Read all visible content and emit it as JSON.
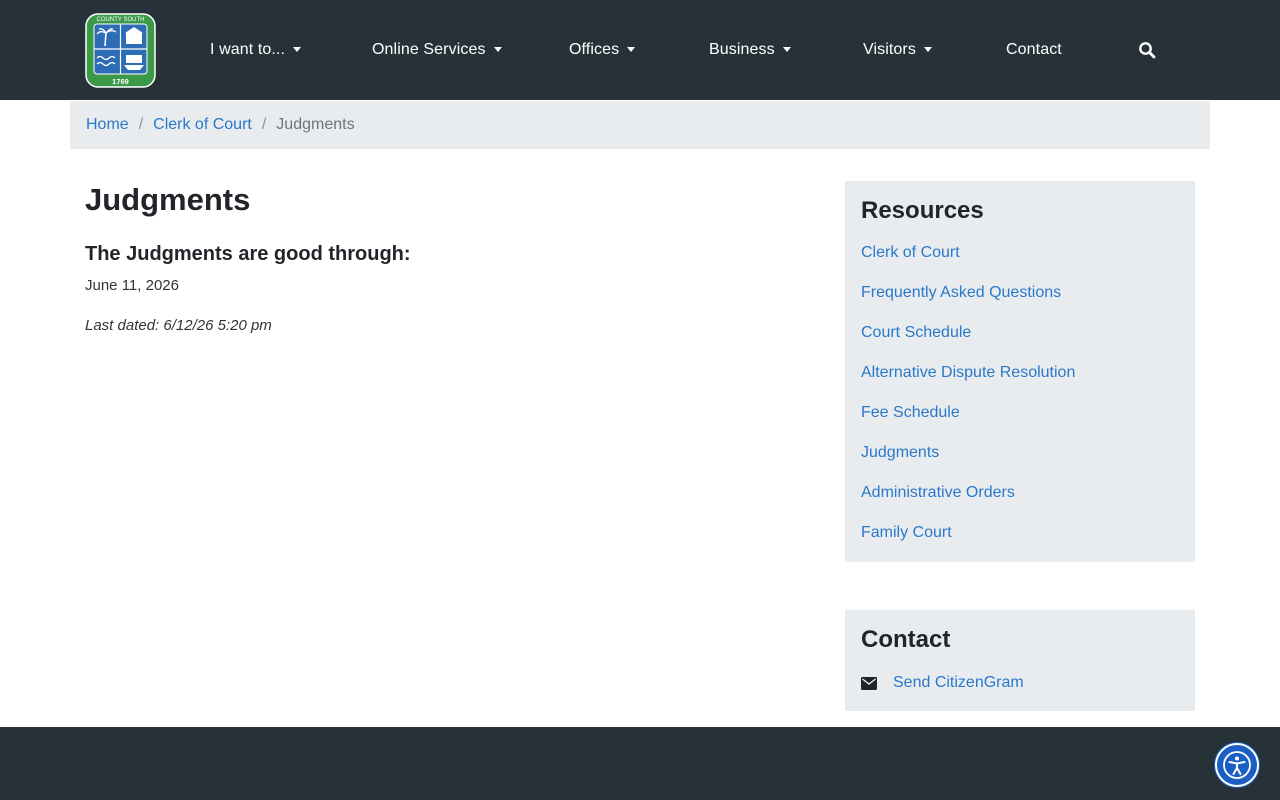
{
  "brand": {
    "logo_alt": "Beaufort County South Carolina seal",
    "logo_top_text": "BEAUFORT COUNTY SOUTH CAROLINA",
    "logo_year": "1769",
    "colors": {
      "header": "#263238",
      "logo_green": "#3a9a48",
      "logo_blue": "#2d6db5",
      "link": "#2a78c9",
      "panel": "#e9ecef"
    }
  },
  "nav": {
    "items": [
      {
        "label": "I want to...",
        "dropdown": true
      },
      {
        "label": "Online Services",
        "dropdown": true
      },
      {
        "label": "Offices",
        "dropdown": true
      },
      {
        "label": "Business",
        "dropdown": true
      },
      {
        "label": "Visitors",
        "dropdown": true
      },
      {
        "label": "Contact",
        "dropdown": false
      }
    ],
    "search_icon": "search-icon"
  },
  "breadcrumb": {
    "items": [
      "Home",
      "Clerk of Court"
    ],
    "separator": "/",
    "current": "Judgments"
  },
  "main": {
    "title": "Judgments",
    "subheading": "The Judgments are good through:",
    "date": "June 11, 2026",
    "last_dated": "Last dated: 6/12/26 5:20 pm"
  },
  "sidebar": {
    "resources_title": "Resources",
    "resources": [
      "Clerk of Court",
      "Frequently Asked Questions",
      "Court Schedule",
      "Alternative Dispute Resolution",
      "Fee Schedule",
      "Judgments",
      "Administrative Orders",
      "Family Court"
    ],
    "contact_title": "Contact",
    "contact_link": "Send CitizenGram",
    "contact_icon": "envelope-icon"
  },
  "footer": {
    "accessibility_icon": "accessibility-icon"
  }
}
